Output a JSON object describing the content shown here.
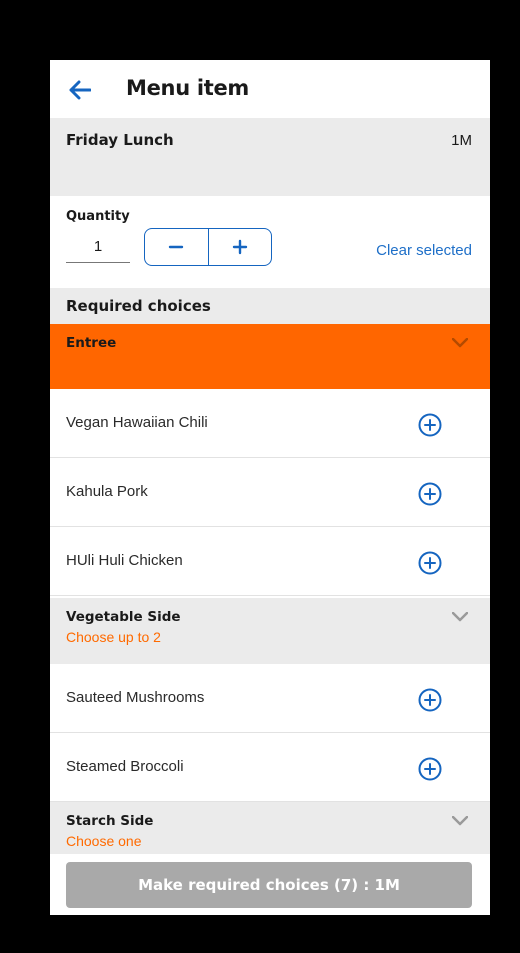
{
  "appbar": {
    "title": "Menu item",
    "back_icon": "arrow-left-icon"
  },
  "meal": {
    "name": "Friday Lunch",
    "price": "1M"
  },
  "quantity": {
    "label": "Quantity",
    "value": "1",
    "minus": "−",
    "plus": "+",
    "clear_label": "Clear selected"
  },
  "required": {
    "title": "Required choices"
  },
  "groups": [
    {
      "title": "Entree",
      "subtitle": "",
      "highlighted": true,
      "items": [
        "Vegan Hawaiian Chili",
        "Kahula Pork",
        "HUli Huli Chicken"
      ]
    },
    {
      "title": "Vegetable Side",
      "subtitle": "Choose up to 2",
      "highlighted": false,
      "items": [
        "Sauteed Mushrooms",
        "Steamed Broccoli"
      ]
    },
    {
      "title": "Starch Side",
      "subtitle": "Choose one",
      "highlighted": false,
      "items": []
    }
  ],
  "cta": {
    "label": "Make required choices (7) : 1M"
  },
  "colors": {
    "accent": "#1565c0",
    "highlight": "#ff6600",
    "section_bg": "#ebebeb",
    "cta_disabled": "#a9a9a9"
  }
}
